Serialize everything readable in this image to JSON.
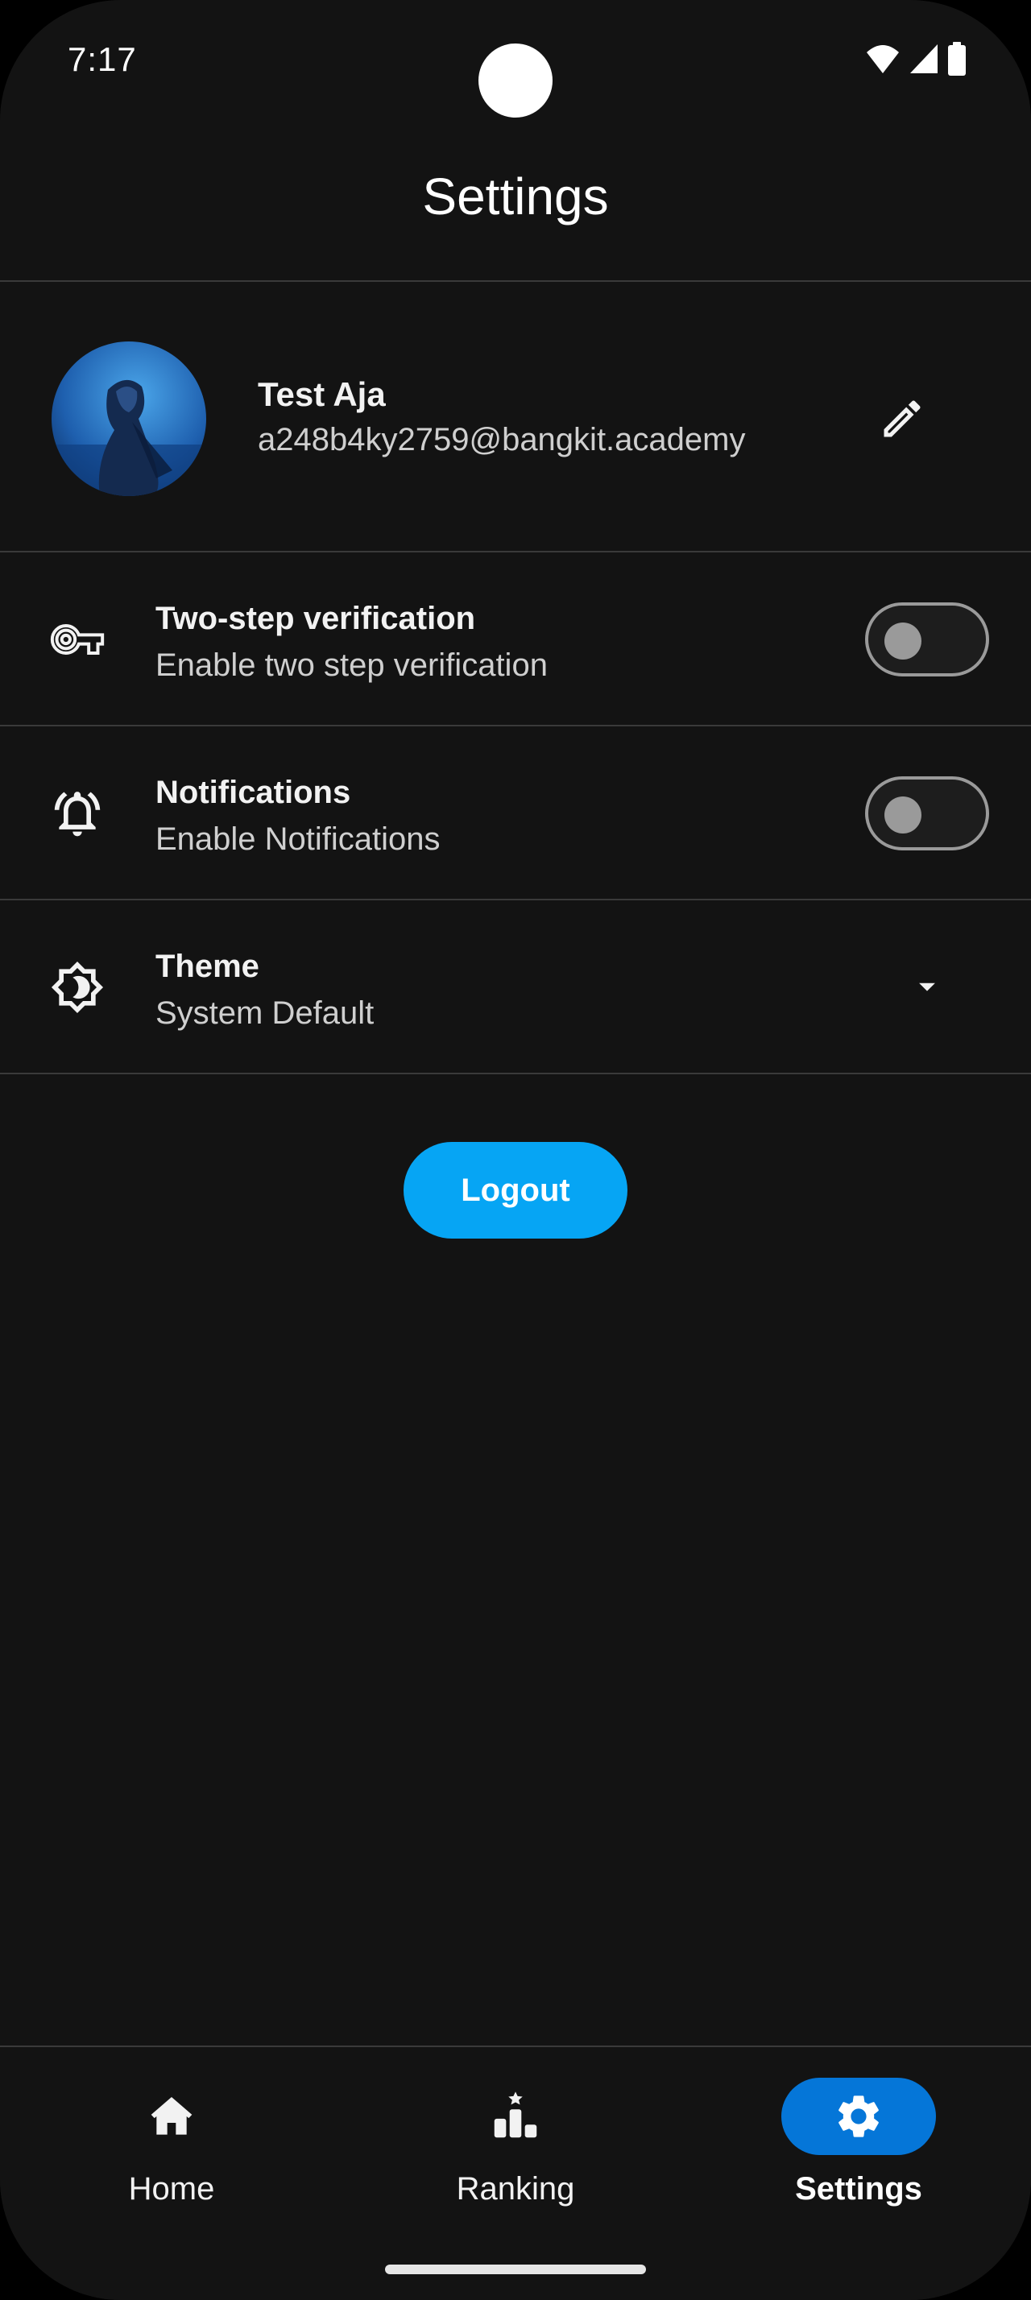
{
  "status_bar": {
    "time": "7:17",
    "icons": [
      "wifi-icon",
      "cell-signal-icon",
      "battery-icon"
    ]
  },
  "header": {
    "title": "Settings"
  },
  "profile": {
    "name": "Test Aja",
    "email": "a248b4ky2759@bangkit.academy",
    "edit_icon": "pencil-icon"
  },
  "settings": {
    "two_step": {
      "title": "Two-step verification",
      "subtitle": "Enable two step verification",
      "icon": "key-icon",
      "enabled": false
    },
    "notifications": {
      "title": "Notifications",
      "subtitle": "Enable Notifications",
      "icon": "bell-icon",
      "enabled": false
    },
    "theme": {
      "title": "Theme",
      "selected": "System Default",
      "icon": "brightness-icon"
    }
  },
  "logout": {
    "label": "Logout"
  },
  "bottom_nav": {
    "items": [
      {
        "label": "Home",
        "icon": "home-icon",
        "active": false
      },
      {
        "label": "Ranking",
        "icon": "podium-icon",
        "active": false
      },
      {
        "label": "Settings",
        "icon": "gear-icon",
        "active": true
      }
    ]
  },
  "colors": {
    "background": "#131313",
    "accent_button": "#06a5f4",
    "active_nav_pill": "#0576d8",
    "divider": "#3a3a3a",
    "toggle_off": "#9a9a9a"
  }
}
